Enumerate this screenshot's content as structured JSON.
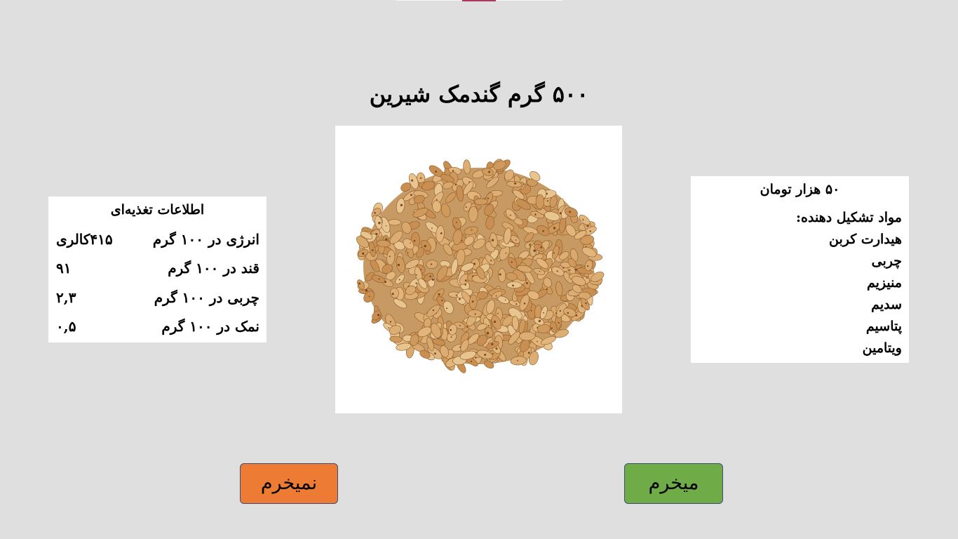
{
  "title": "۵۰۰ گرم گندمک شیرین",
  "nutrition": {
    "heading": "اطلاعات تغذیه‌ای",
    "rows": [
      {
        "label": "انرژی در ۱۰۰ گرم",
        "value": "۴۱۵کالری"
      },
      {
        "label": "قند در ۱۰۰ گرم",
        "value": "۹۱"
      },
      {
        "label": "چربی در ۱۰۰ گرم",
        "value": "۲,۳"
      },
      {
        "label": "نمک در ۱۰۰ گرم",
        "value": "۰,۵"
      }
    ]
  },
  "product": {
    "price": "۵۰ هزار تومان",
    "ingredients_heading": "مواد تشکیل دهنده:",
    "ingredients": [
      "هیدارت کربن",
      "چربی",
      "منیزیم",
      "سدیم",
      "پتاسیم",
      "ویتامین"
    ]
  },
  "buttons": {
    "reject_label": "نمیخرم",
    "buy_label": "میخرم"
  },
  "colors": {
    "background": "#dfdfdf",
    "reject_button": "#ee7b33",
    "buy_button": "#6fac47",
    "button_border": "#3d4f78",
    "top_accent": "#b0385c"
  }
}
